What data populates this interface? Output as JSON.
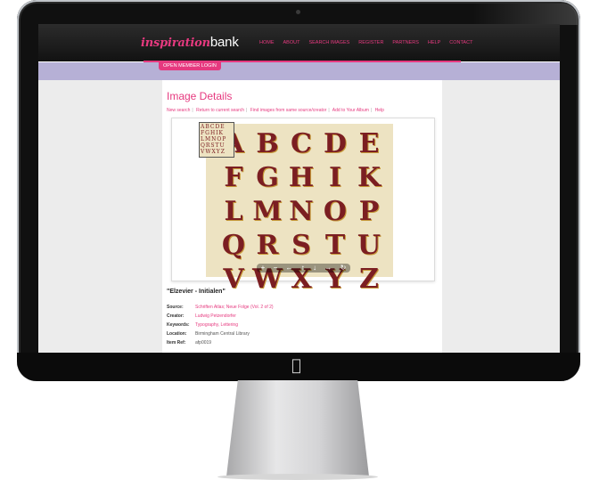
{
  "site": {
    "logo_part1": "inspiration",
    "logo_part2": "bank",
    "nav": [
      "HOME",
      "ABOUT",
      "SEARCH IMAGES",
      "REGISTER",
      "PARTNERS",
      "HELP",
      "CONTACT"
    ],
    "login_button": "OPEN MEMBER LOGIN"
  },
  "page": {
    "title": "Image Details",
    "links": [
      "New search",
      "Return to current search",
      "Find images from same source/creator",
      "Add to Your Album",
      "Help"
    ]
  },
  "image": {
    "letters": [
      "A",
      "B",
      "C",
      "D",
      "E",
      "F",
      "G",
      "H",
      "I",
      "K",
      "L",
      "M",
      "N",
      "O",
      "P",
      "Q",
      "R",
      "S",
      "T",
      "U",
      "V",
      "W",
      "X",
      "Y",
      "Z"
    ],
    "thumb_text": "ABCDE\nFGHIK\nLMNOP\nQRSTU\nVWXYZ",
    "controls": [
      "+",
      "−",
      "←",
      "↑",
      "↓",
      "→",
      "↻"
    ]
  },
  "item": {
    "title": "\"Elzevier - Initialen\"",
    "fields": [
      {
        "label": "Source:",
        "value": "Schriften Atlas; Neue Folge (Vol. 2 of 2)",
        "link": true
      },
      {
        "label": "Creator:",
        "value": "Ludwig Petzendorfer",
        "link": true
      },
      {
        "label": "Keywords:",
        "value": "Typography, Lettering",
        "link": true
      },
      {
        "label": "Location:",
        "value": "Birmingham Central Library",
        "link": false
      },
      {
        "label": "Item Ref:",
        "value": "afp0019",
        "link": false
      }
    ]
  },
  "colors": {
    "accent": "#e6397f",
    "lavender": "#b6b0d6",
    "dark": "#1a1a1a"
  }
}
